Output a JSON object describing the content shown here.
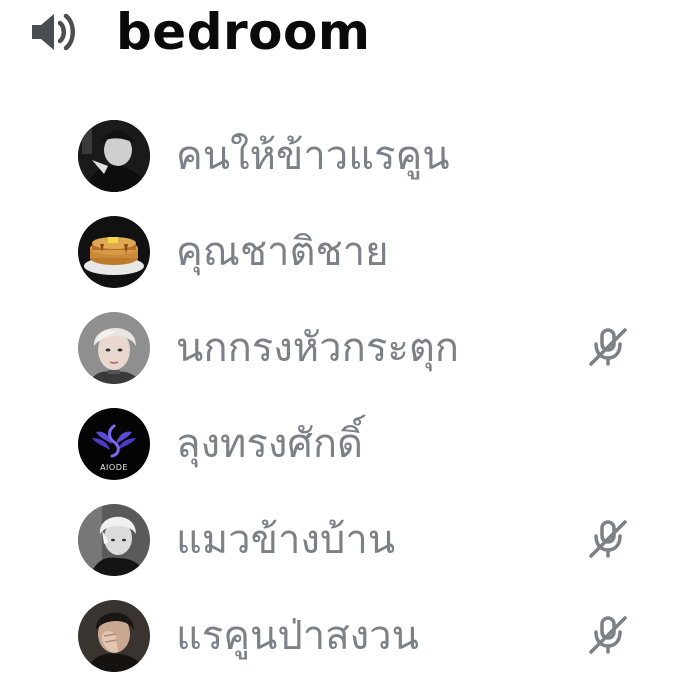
{
  "channel": {
    "name": "bedroom",
    "icon": "speaker-icon"
  },
  "members": [
    {
      "name": "คนให้ข้าวแรคูน",
      "avatar": "avatar-dark-portrait",
      "muted": false
    },
    {
      "name": "คุณชาติชาย",
      "avatar": "avatar-pancakes",
      "muted": false
    },
    {
      "name": "นกกรงหัวกระตุก",
      "avatar": "avatar-blond-portrait",
      "muted": true
    },
    {
      "name": "ลุงทรงศักดิ์",
      "avatar": "avatar-aiode-logo",
      "avatar_logo_text": "AIODE",
      "muted": false
    },
    {
      "name": "แมวข้างบ้าน",
      "avatar": "avatar-silver-hair-portrait",
      "muted": true
    },
    {
      "name": "แรคูนป่าสงวน",
      "avatar": "avatar-hand-over-face-portrait",
      "muted": true
    }
  ],
  "colors": {
    "name_text": "#7c8087",
    "header_text": "#0a0a0a",
    "mute_icon": "#7c8087"
  }
}
